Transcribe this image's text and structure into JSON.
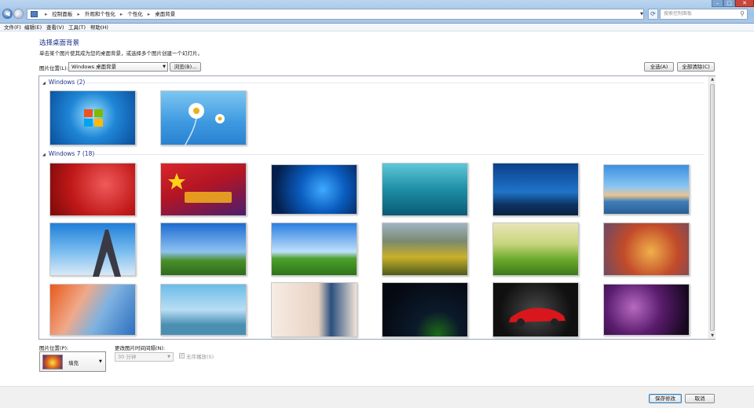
{
  "addressbar": {
    "crumbs": [
      "控制面板",
      "外观和个性化",
      "个性化",
      "桌面背景"
    ],
    "search_placeholder": "搜索控制面板"
  },
  "menubar": [
    "文件(F)",
    "编辑(E)",
    "查看(V)",
    "工具(T)",
    "帮助(H)"
  ],
  "header": {
    "title": "选择桌面背景",
    "subtitle": "单击某个图片使其成为您的桌面背景，或选择多个图片创建一个幻灯片。"
  },
  "location": {
    "label": "图片位置(L):",
    "value": "Windows 桌面背景",
    "browse_label": "浏览(B)...",
    "select_all_label": "全选(A)",
    "clear_all_label": "全部清除(C)"
  },
  "groups": [
    {
      "title": "Windows (2)",
      "icon": "expand-triangle-icon",
      "items": [
        "windows7-logo",
        "daisies"
      ]
    },
    {
      "title": "Windows 7 (18)",
      "icon": "expand-triangle-icon",
      "items": [
        "red-windows7",
        "national-day",
        "windows10-blue",
        "underwater",
        "blue-rays",
        "beach-rocks",
        "eiffel-tower",
        "windmill-sky",
        "green-field-clouds",
        "autumn-forest",
        "leaf-grass",
        "bokeh-leaves",
        "blur-gradient",
        "anime-girl",
        "girl-portrait",
        "milky-way",
        "red-sports-car",
        "purple-petals"
      ]
    }
  ],
  "position": {
    "label": "图片位置(P):",
    "value": "填充"
  },
  "interval": {
    "label": "更改图片时间间隔(N):",
    "value": "30 分钟"
  },
  "shuffle": {
    "label": "无序播放(S)",
    "checked": true
  },
  "footer": {
    "save_label": "保存修改",
    "cancel_label": "取消"
  },
  "window_buttons": {
    "minimize": "–",
    "maximize": "□",
    "close": "✕"
  }
}
